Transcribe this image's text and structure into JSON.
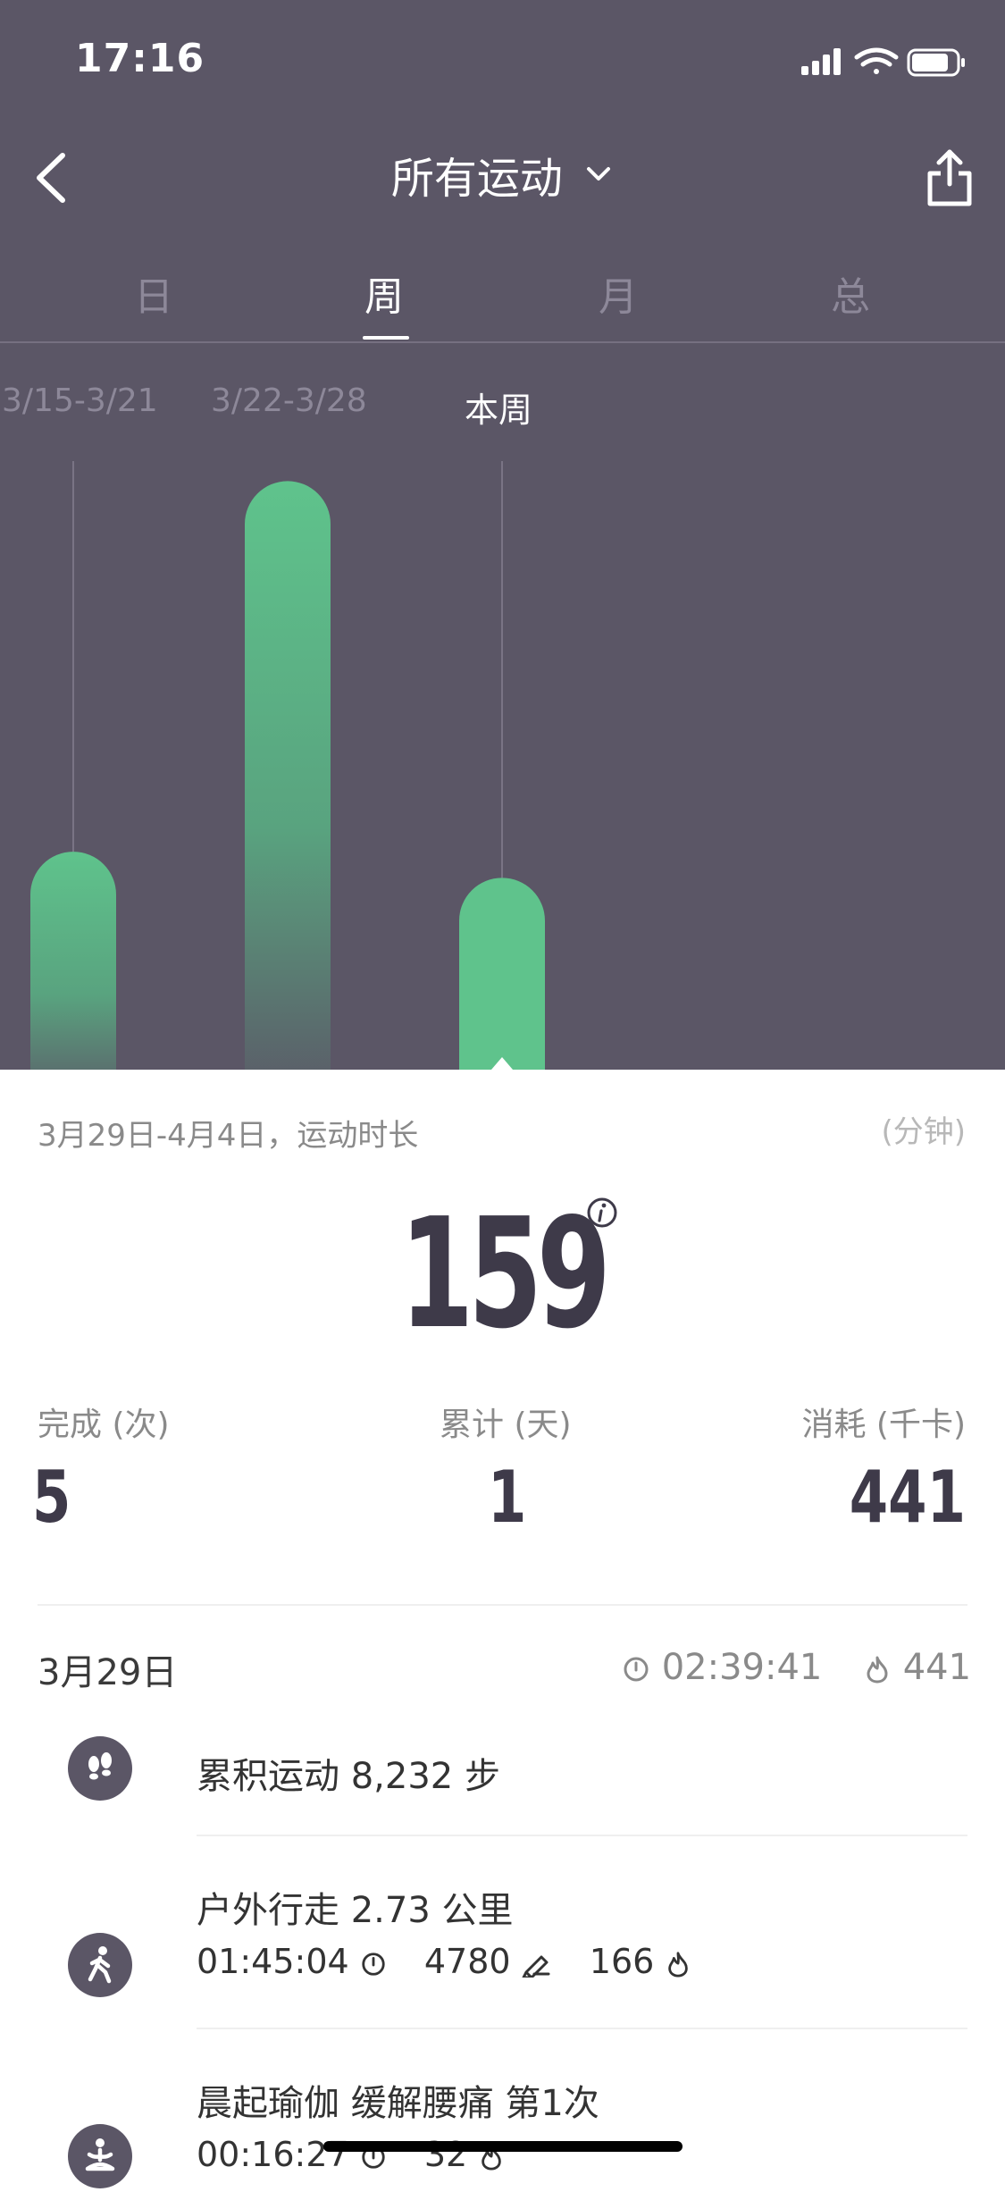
{
  "status_bar": {
    "time": "17:16"
  },
  "nav": {
    "title": "所有运动"
  },
  "tabs": [
    {
      "label": "日"
    },
    {
      "label": "周"
    },
    {
      "label": "月"
    },
    {
      "label": "总"
    }
  ],
  "active_tab": "周",
  "periods": [
    {
      "label": "3/15-3/21"
    },
    {
      "label": "3/22-3/28"
    },
    {
      "label": "本周"
    }
  ],
  "colors": {
    "header_bg": "#5b5666",
    "bar_green": "#5fc38c",
    "text_dark": "#3e3a49"
  },
  "chart_data": {
    "type": "bar",
    "categories": [
      "3/15-3/21",
      "3/22-3/28",
      "本周"
    ],
    "values": [
      150,
      405,
      132
    ],
    "ylim": [
      0,
      420
    ],
    "selected": "本周",
    "grid": false
  },
  "summary": {
    "label": "3月29日-4月4日，运动时长",
    "unit": "(分钟)",
    "value": "159"
  },
  "stats": [
    {
      "label": "完成 (次)",
      "value": "5"
    },
    {
      "label": "累计 (天)",
      "value": "1"
    },
    {
      "label": "消耗 (千卡)",
      "value": "441"
    }
  ],
  "day": {
    "date": "3月29日",
    "duration": "02:39:41",
    "calories": "441"
  },
  "activities": [
    {
      "title": "累积运动 8,232 步",
      "icon": "footprints-icon"
    },
    {
      "title": "户外行走 2.73 公里",
      "icon": "walking-icon",
      "duration": "01:45:04",
      "steps": "4780",
      "calories": "166"
    },
    {
      "title": "晨起瑜伽 缓解腰痛  第1次",
      "icon": "yoga-icon",
      "duration": "00:16:27",
      "calories": "32"
    }
  ]
}
